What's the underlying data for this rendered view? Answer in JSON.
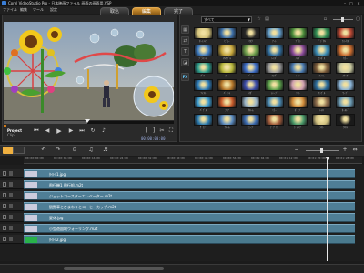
{
  "window": {
    "title": "Corel VideoStudio Pro - 日本映画ファイル 画面の画面用.VSP",
    "controls": [
      "–",
      "□",
      "✕"
    ]
  },
  "menu": {
    "items": [
      "ファイル",
      "編集",
      "ツール",
      "設定"
    ]
  },
  "steps": {
    "capture": "取込",
    "edit": "編集",
    "share": "完了",
    "active": "edit"
  },
  "preview": {
    "project_label": "Project",
    "clip_label": "Clip",
    "timecode": "00:00:00:00",
    "scrub_position": 0.49
  },
  "library": {
    "dropdown_value": "すべて",
    "dropdown_arrow": "▼",
    "side_icons": [
      "film-strip-icon",
      "transition-icon",
      "title-icon",
      "graphic-icon",
      "fx-icon"
    ],
    "fx_label": "FX",
    "zoom_level": 0.45,
    "thumbnails": [
      {
        "label": "ｵｰﾄﾒｲｸ",
        "color": "#d4c37a"
      },
      {
        "label": "ﾋﾞｭｰ",
        "color": "#3b6ea8"
      },
      {
        "label": "ﾏｽｸ",
        "color": "#262626"
      },
      {
        "label": "ｱｰﾄ",
        "color": "#5f9ac8"
      },
      {
        "label": "ﾌﾞﾗｼ",
        "color": "#4a8c3a"
      },
      {
        "label": "ﾃﾞｼﾞﾀﾙ",
        "color": "#2e8a52"
      },
      {
        "label": "ﾌｫｰｶｽ",
        "color": "#b84632"
      },
      {
        "label": "ﾌﾞﾗｲﾝﾄﾞ",
        "color": "#3c7ac0"
      },
      {
        "label": "ﾏﾙﾁﾌﾟﾙ",
        "color": "#c4a43a"
      },
      {
        "label": "ﾓｻﾞｲｸ",
        "color": "#6a9a4a"
      },
      {
        "label": "ﾚﾝｽﾞ",
        "color": "#2f6ea0"
      },
      {
        "label": "ﾉｲｽﾞ",
        "color": "#8a4a9a"
      },
      {
        "label": "ｴﾝﾎﾞｽ",
        "color": "#3a8ab4"
      },
      {
        "label": "ｶﾗｰ",
        "color": "#c86a2e"
      },
      {
        "label": "ｸﾞﾛｰ",
        "color": "#2a9a8a"
      },
      {
        "label": "ｽﾀｰ",
        "color": "#b4b43a"
      },
      {
        "label": "ﾊﾞｰﾝ",
        "color": "#3a6ac4"
      },
      {
        "label": "ﾌｫｸﾞ",
        "color": "#9a9a9a"
      },
      {
        "label": "ﾚｲﾝ",
        "color": "#4a7ab0"
      },
      {
        "label": "ﾌｨﾙﾑ",
        "color": "#7a5a3a"
      },
      {
        "label": "ｽｹｯﾁ",
        "color": "#c8c8a0"
      },
      {
        "label": "ﾂｲｽﾄ",
        "color": "#2a7ab8"
      },
      {
        "label": "ﾍﾟｲﾝﾄ",
        "color": "#b4762a"
      },
      {
        "label": "ﾈｶﾞ",
        "color": "#3a4aa8"
      },
      {
        "label": "ｼｬｰﾌﾟ",
        "color": "#5aa04a"
      },
      {
        "label": "ｿﾌﾄ",
        "color": "#d0a0b0"
      },
      {
        "label": "ﾘｯﾌﾟﾙ",
        "color": "#2a6a9a"
      },
      {
        "label": "ﾜｰﾌﾟ",
        "color": "#8ab4d8"
      },
      {
        "label": "ﾊﾞﾌﾞﾙ",
        "color": "#3a9ad0"
      },
      {
        "label": "ﾌﾚｱ",
        "color": "#c85a2a"
      },
      {
        "label": "ｸﾛｰﾑ",
        "color": "#9ab4c8"
      },
      {
        "label": "ﾐﾗｰ",
        "color": "#4a8ab4"
      },
      {
        "label": "ﾎﾟｯﾌﾟ",
        "color": "#d08a3a"
      },
      {
        "label": "ﾚﾄﾛ",
        "color": "#8a6a4a"
      },
      {
        "label": "ｵｰﾙﾄﾞ",
        "color": "#6a9ab4"
      },
      {
        "label": "ｸﾞﾗﾃﾞ",
        "color": "#2a7ab0"
      },
      {
        "label": "ﾌﾚｰﾑ",
        "color": "#5a8ac0"
      },
      {
        "label": "ｳｪｰﾌﾞ",
        "color": "#3a6ab0"
      },
      {
        "label": "ﾃﾞﾌﾞﾘｽ",
        "color": "#a05a3a"
      },
      {
        "label": "ｼﾞｬﾝﾌﾟ",
        "color": "#4a9a6a"
      },
      {
        "label": "ﾗｲﾄ",
        "color": "#d0c080"
      },
      {
        "label": "ﾀｲﾙ",
        "color": "#1a1a1a"
      }
    ]
  },
  "timeline": {
    "ruler_labels": [
      "00:00:00:00",
      "00:00:08:00",
      "00:00:16:00",
      "00:00:24:00",
      "00:00:32:00",
      "00:00:40:00",
      "00:00:48:00",
      "00:00:56:00",
      "00:01:04:00",
      "00:01:12:00",
      "00:01:20:00",
      "00:01:28:00"
    ],
    "clips": [
      "ﾀｲﾄﾙ1.jpg",
      "飛行機1 飛行船.m2t",
      "ジェットコースターエレベーター.m2t",
      "観覧車とひまわりとコーヒーカップ.m2t",
      "夏休.jpg",
      "小型遊園地ウォーリング.m2t",
      "ﾀｲﾄﾙ2.jpg"
    ]
  }
}
